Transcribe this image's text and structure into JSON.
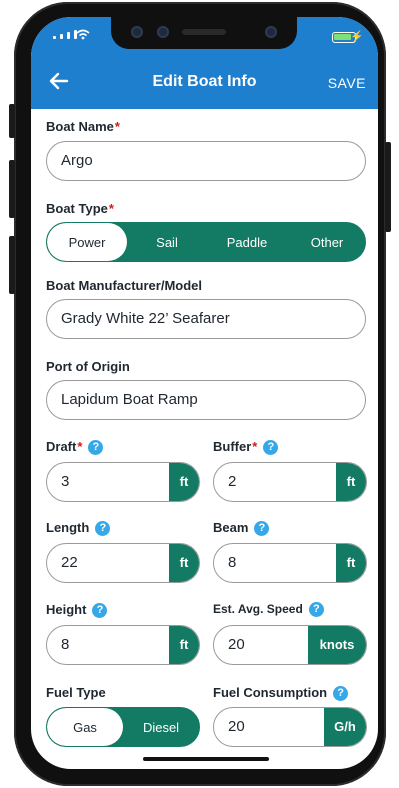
{
  "header": {
    "title": "Edit Boat Info",
    "save_label": "SAVE"
  },
  "form": {
    "boat_name": {
      "label": "Boat Name",
      "value": "Argo"
    },
    "boat_type": {
      "label": "Boat Type",
      "options": [
        "Power",
        "Sail",
        "Paddle",
        "Other"
      ],
      "selected": "Power"
    },
    "manufacturer": {
      "label": "Boat Manufacturer/Model",
      "value": "Grady White 22’ Seafarer"
    },
    "port": {
      "label": "Port of Origin",
      "value": "Lapidum Boat Ramp"
    },
    "draft": {
      "label": "Draft",
      "value": "3",
      "unit": "ft"
    },
    "buffer": {
      "label": "Buffer",
      "value": "2",
      "unit": "ft"
    },
    "length": {
      "label": "Length",
      "value": "22",
      "unit": "ft"
    },
    "beam": {
      "label": "Beam",
      "value": "8",
      "unit": "ft"
    },
    "height": {
      "label": "Height",
      "value": "8",
      "unit": "ft"
    },
    "speed": {
      "label": "Est. Avg. Speed",
      "value": "20",
      "unit": "knots"
    },
    "fuel_type": {
      "label": "Fuel Type",
      "options": [
        "Gas",
        "Diesel"
      ],
      "selected": "Gas"
    },
    "fuel_consumption": {
      "label": "Fuel Consumption",
      "value": "20",
      "unit": "G/h"
    }
  },
  "required_mark": "*",
  "help_glyph": "?",
  "colors": {
    "appbar": "#1f7fcf",
    "accent": "#137a63",
    "help": "#36a8e8",
    "required": "#d11a1a"
  }
}
